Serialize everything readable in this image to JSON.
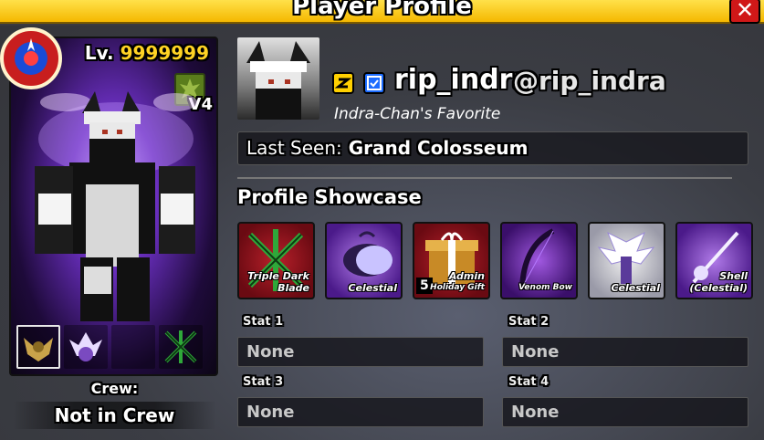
{
  "window": {
    "title": "Player Profile",
    "close_glyph": "✕"
  },
  "character": {
    "level_prefix": "Lv.",
    "level_value": "9999999",
    "race_version": "V4",
    "equip_slots": [
      "winged-helm-accessory",
      "celestial-fruit",
      "",
      "triple-dark-blade"
    ]
  },
  "crew": {
    "label": "Crew:",
    "value": "Not in Crew"
  },
  "profile": {
    "display_name": "rip_indra",
    "username": "@rip_indra",
    "subtitle": "Indra-Chan's Favorite",
    "last_seen_label": "Last Seen:",
    "last_seen_value": "Grand Colosseum"
  },
  "showcase": {
    "title": "Profile Showcase",
    "items": [
      {
        "caption_line1": "Triple Dark",
        "caption_line2": "Blade",
        "count": ""
      },
      {
        "caption_line1": "Celestial",
        "caption_line2": "",
        "count": ""
      },
      {
        "caption_line1": "Admin",
        "caption_line2": "Holiday Gift",
        "count": "5"
      },
      {
        "caption_line1": "Venom Bow",
        "caption_line2": "",
        "count": ""
      },
      {
        "caption_line1": "Celestial",
        "caption_line2": "",
        "count": ""
      },
      {
        "caption_line1": "Shell",
        "caption_line2": "(Celestial)",
        "count": ""
      }
    ]
  },
  "stats": [
    {
      "label": "Stat 1",
      "value": "None"
    },
    {
      "label": "Stat 2",
      "value": "None"
    },
    {
      "label": "Stat 3",
      "value": "None"
    },
    {
      "label": "Stat 4",
      "value": "None"
    }
  ],
  "colors": {
    "title_bar": "#f5b800",
    "level_number": "#ffd324",
    "close_button": "#d01818"
  }
}
